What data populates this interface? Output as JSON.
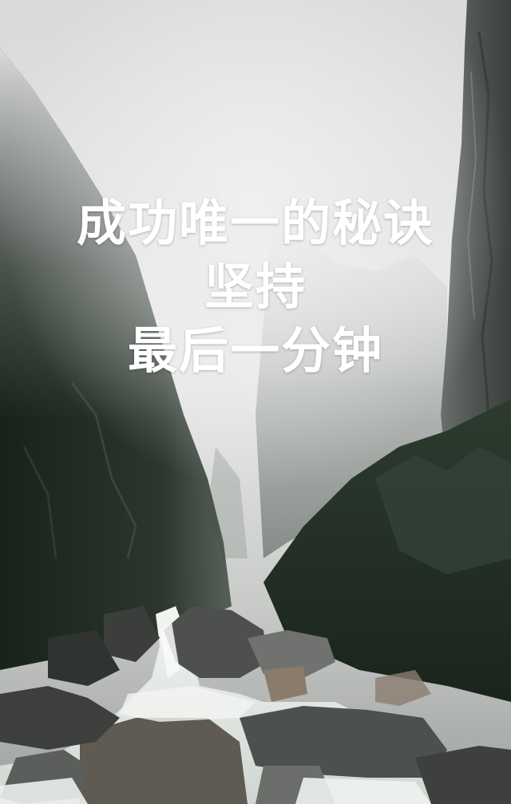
{
  "quote": {
    "line1": "成功唯一的秘诀",
    "line2": "坚持",
    "line3": "最后一分钟"
  },
  "colors": {
    "text": "#ffffff",
    "fog": "#e8e9e8",
    "cliff_dark": "#1f2a22",
    "rock": "#5a5d5a",
    "water": "#eef1ee"
  }
}
